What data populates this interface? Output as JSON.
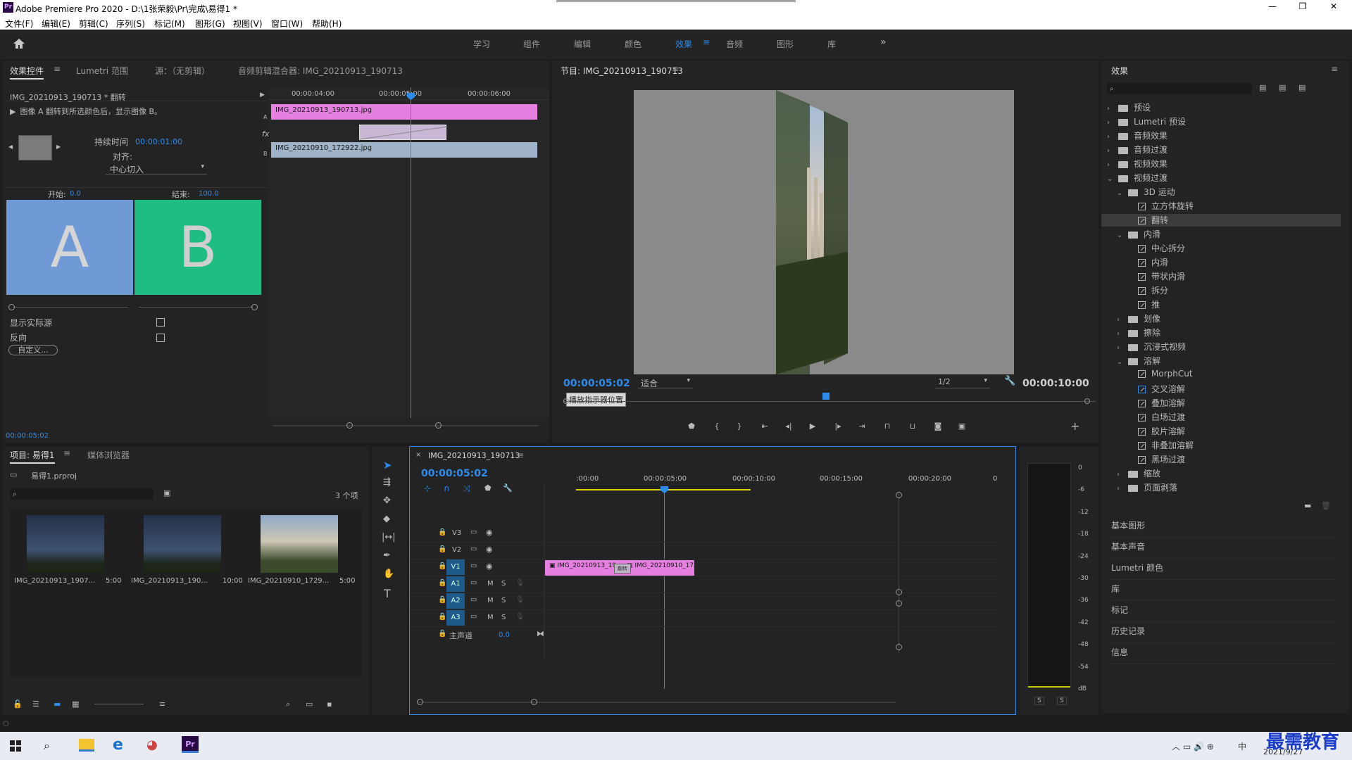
{
  "window": {
    "title": "Adobe Premiere Pro 2020 - D:\\1张荣毅\\Pr\\完成\\易得1 *",
    "controls": [
      "—",
      "❐",
      "✕"
    ]
  },
  "menu": [
    "文件(F)",
    "编辑(E)",
    "剪辑(C)",
    "序列(S)",
    "标记(M)",
    "图形(G)",
    "视图(V)",
    "窗口(W)",
    "帮助(H)"
  ],
  "workspaces": {
    "tabs": [
      "学习",
      "组件",
      "编辑",
      "颜色",
      "效果",
      "音频",
      "图形",
      "库"
    ],
    "active": "效果",
    "more": "»"
  },
  "effect_controls": {
    "tabs": [
      "效果控件",
      "Lumetri 范围",
      "源：（无剪辑）",
      "音频剪辑混合器: IMG_20210913_190713"
    ],
    "clip_label": "IMG_20210913_190713 * 翻转",
    "description": "图像 A 翻转到所选颜色后，显示图像 B。",
    "duration_label": "持续时间",
    "duration_value": "00:00:01:00",
    "align_label": "对齐:",
    "align_value": "中心切入",
    "start_label": "开始:",
    "start_value": "0.0",
    "end_label": "结束:",
    "end_value": "100.0",
    "a_label": "A",
    "b_label": "B",
    "show_source": "显示实际源",
    "reverse": "反向",
    "custom_btn": "自定义...",
    "timecode": "00:00:05:02",
    "ruler": [
      "00:00:04:00",
      "00:00:05:00",
      "00:00:06:00"
    ],
    "clip_a": "IMG_20210913_190713.jpg",
    "clip_b": "IMG_20210910_172922.jpg",
    "track_a": "A",
    "track_b": "B",
    "fx_glyph": "fx"
  },
  "program": {
    "title": "节目: IMG_20210913_190713",
    "timecode": "00:00:05:02",
    "fit": "适合",
    "resolution": "1/2",
    "duration": "00:00:10:00",
    "tooltip": "播放指示器位置"
  },
  "effects_panel": {
    "title": "效果",
    "tree": [
      {
        "label": "预设",
        "level": 0,
        "type": "folder",
        "open": false
      },
      {
        "label": "Lumetri 预设",
        "level": 0,
        "type": "folder",
        "open": false
      },
      {
        "label": "音频效果",
        "level": 0,
        "type": "folder",
        "open": false
      },
      {
        "label": "音频过渡",
        "level": 0,
        "type": "folder",
        "open": false
      },
      {
        "label": "视频效果",
        "level": 0,
        "type": "folder",
        "open": false
      },
      {
        "label": "视频过渡",
        "level": 0,
        "type": "folder",
        "open": true
      },
      {
        "label": "3D 运动",
        "level": 1,
        "type": "folder",
        "open": true
      },
      {
        "label": "立方体旋转",
        "level": 2,
        "type": "fx"
      },
      {
        "label": "翻转",
        "level": 2,
        "type": "fx",
        "selected": true
      },
      {
        "label": "内滑",
        "level": 1,
        "type": "folder",
        "open": true
      },
      {
        "label": "中心拆分",
        "level": 2,
        "type": "fx"
      },
      {
        "label": "内滑",
        "level": 2,
        "type": "fx"
      },
      {
        "label": "带状内滑",
        "level": 2,
        "type": "fx"
      },
      {
        "label": "拆分",
        "level": 2,
        "type": "fx"
      },
      {
        "label": "推",
        "level": 2,
        "type": "fx"
      },
      {
        "label": "划像",
        "level": 1,
        "type": "folder",
        "open": false
      },
      {
        "label": "擦除",
        "level": 1,
        "type": "folder",
        "open": false
      },
      {
        "label": "沉浸式视频",
        "level": 1,
        "type": "folder",
        "open": false
      },
      {
        "label": "溶解",
        "level": 1,
        "type": "folder",
        "open": true
      },
      {
        "label": "MorphCut",
        "level": 2,
        "type": "fx"
      },
      {
        "label": "交叉溶解",
        "level": 2,
        "type": "fx"
      },
      {
        "label": "叠加溶解",
        "level": 2,
        "type": "fx"
      },
      {
        "label": "白场过渡",
        "level": 2,
        "type": "fx"
      },
      {
        "label": "胶片溶解",
        "level": 2,
        "type": "fx"
      },
      {
        "label": "非叠加溶解",
        "level": 2,
        "type": "fx"
      },
      {
        "label": "黑场过渡",
        "level": 2,
        "type": "fx"
      },
      {
        "label": "缩放",
        "level": 1,
        "type": "folder",
        "open": false
      },
      {
        "label": "页面剥落",
        "level": 1,
        "type": "folder",
        "open": false
      }
    ],
    "side_panels": [
      "基本图形",
      "基本声音",
      "Lumetri 颜色",
      "库",
      "标记",
      "历史记录",
      "信息"
    ]
  },
  "project": {
    "tabs": [
      "项目: 易得1",
      "媒体浏览器"
    ],
    "file": "易得1.prproj",
    "count": "3 个项",
    "items": [
      {
        "name": "IMG_20210913_1907...",
        "duration": "5:00"
      },
      {
        "name": "IMG_20210913_190...",
        "duration": "10:00"
      },
      {
        "name": "IMG_20210910_1729...",
        "duration": "5:00"
      }
    ]
  },
  "timeline": {
    "tab": "IMG_20210913_190713",
    "timecode": "00:00:05:02",
    "ruler": [
      ":00:00",
      "00:00:05:00",
      "00:00:10:00",
      "00:00:15:00",
      "00:00:20:00",
      "0"
    ],
    "tracks": [
      "V3",
      "V2",
      "V1",
      "A1",
      "A2",
      "A3"
    ],
    "master": "主声道",
    "master_value": "0.0",
    "clip1": "IMG_20210913_19",
    "clip2": "IMG_20210910_172",
    "transition_label": "翻转",
    "mute_label": "M",
    "solo_label": "S"
  },
  "meter": {
    "scale": [
      "0",
      "-6",
      "-12",
      "-18",
      "-24",
      "-30",
      "-36",
      "-42",
      "-48",
      "-54",
      "dB"
    ],
    "solo": [
      "S",
      "S"
    ]
  },
  "taskbar": {
    "date": "2021/9/27",
    "ime": "中",
    "watermark": "最需教育"
  },
  "colors": {
    "accent": "#2d8ceb",
    "clip_pink": "#e57fe0",
    "clip_blue": "#9fb3c8",
    "a_color": "#6f9ad6",
    "b_color": "#1ebd82"
  }
}
